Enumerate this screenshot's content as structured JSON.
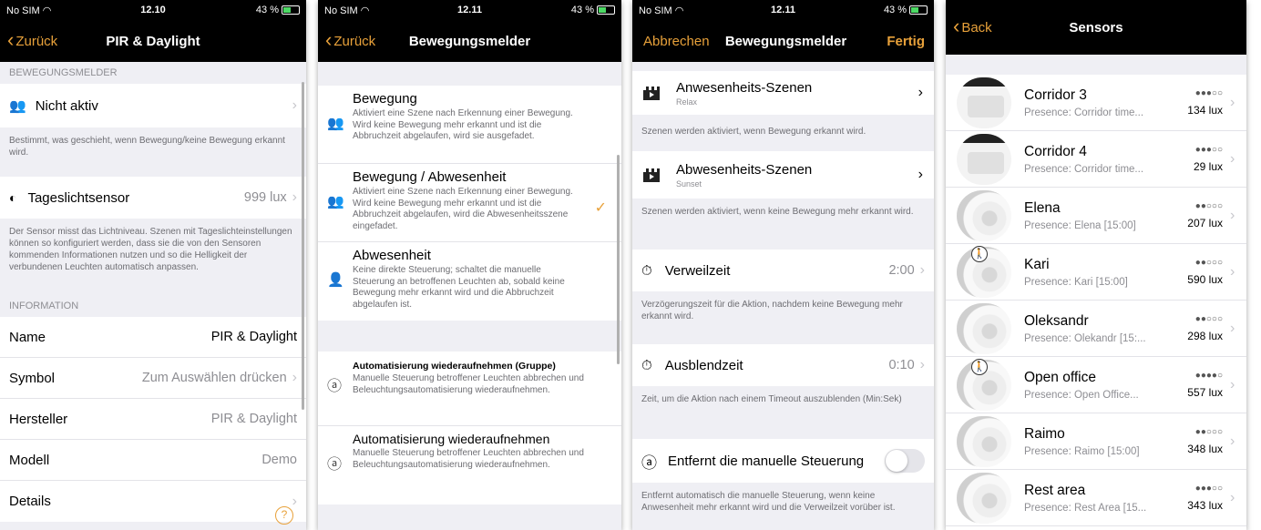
{
  "accent_color": "#e8a13a",
  "panels": [
    {
      "status": {
        "carrier": "No SIM",
        "time": "12.10",
        "battery": "43 %"
      },
      "nav": {
        "back": "Zurück",
        "title": "PIR & Daylight"
      },
      "section_motion": "BEWEGUNGSMELDER",
      "motion_cell": {
        "label": "Nicht aktiv"
      },
      "motion_footer": "Bestimmt, was geschieht, wenn Bewegung/keine Bewegung erkannt wird.",
      "daylight_cell": {
        "label": "Tageslichtsensor",
        "value": "999 lux"
      },
      "daylight_footer": "Der Sensor misst das Lichtniveau. Szenen mit Tageslichteinstellungen können so konfiguriert werden, dass sie die von den Sensoren kommenden Informationen nutzen und so die Helligkeit der verbundenen Leuchten automatisch anpassen.",
      "section_info": "INFORMATION",
      "info_rows": [
        {
          "label": "Name",
          "value": "PIR & Daylight"
        },
        {
          "label": "Symbol",
          "value": "Zum Auswählen drücken"
        },
        {
          "label": "Hersteller",
          "value": "PIR & Daylight"
        },
        {
          "label": "Modell",
          "value": "Demo"
        },
        {
          "label": "Details",
          "value": ""
        }
      ]
    },
    {
      "status": {
        "carrier": "No SIM",
        "time": "12.11",
        "battery": "43 %"
      },
      "nav": {
        "back": "Zurück",
        "title": "Bewegungsmelder"
      },
      "options": [
        {
          "title": "Bewegung",
          "desc": "Aktiviert eine Szene nach Erkennung einer Bewegung. Wird keine Bewegung mehr erkannt und ist die Abbruchzeit abgelaufen, wird sie ausgefadet."
        },
        {
          "title": "Bewegung / Abwesenheit",
          "desc": "Aktiviert eine Szene nach Erkennung einer Bewegung. Wird keine Bewegung mehr erkannt und ist die Abbruchzeit abgelaufen, wird die Abwesenheitsszene eingefadet.",
          "checked": "✓"
        },
        {
          "title": "Abwesenheit",
          "desc": "Keine direkte Steuerung; schaltet die manuelle Steuerung an betroffenen Leuchten ab, sobald keine Bewegung mehr erkannt wird und die Abbruchzeit abgelaufen ist."
        }
      ],
      "auto_options": [
        {
          "title": "Automatisierung wiederaufnehmen (Gruppe)",
          "desc": "Manuelle Steuerung betroffener Leuchten abbrechen und Beleuchtungsautomatisierung wiederaufnehmen."
        },
        {
          "title": "Automatisierung wiederaufnehmen",
          "desc": "Manuelle Steuerung betroffener Leuchten abbrechen und Beleuchtungsautomatisierung wiederaufnehmen."
        }
      ]
    },
    {
      "status": {
        "carrier": "No SIM",
        "time": "12.11",
        "battery": "43 %"
      },
      "nav": {
        "back": "Abbrechen",
        "title": "Bewegungsmelder",
        "done": "Fertig"
      },
      "presence_scene": {
        "label": "Anwesenheits-Szenen",
        "sub": "Relax"
      },
      "presence_footer": "Szenen werden aktiviert, wenn Bewegung erkannt wird.",
      "absence_scene": {
        "label": "Abwesenheits-Szenen",
        "sub": "Sunset"
      },
      "absence_footer": "Szenen werden aktiviert, wenn keine Bewegung mehr erkannt wird.",
      "dwell": {
        "label": "Verweilzeit",
        "value": "2:00"
      },
      "dwell_footer": "Verzögerungszeit für die Aktion, nachdem keine Bewegung mehr erkannt wird.",
      "fade": {
        "label": "Ausblendzeit",
        "value": "0:10"
      },
      "fade_footer": "Zeit, um die Aktion nach einem Timeout auszublenden (Min:Sek)",
      "manual": {
        "label": "Entfernt die manuelle Steuerung"
      },
      "manual_footer": "Entfernt automatisch die manuelle Steuerung, wenn keine Anwesenheit mehr erkannt wird und die Verweilzeit vorüber ist."
    },
    {
      "nav": {
        "back": "Back",
        "title": "Sensors"
      },
      "sensors": [
        {
          "name": "Corridor 3",
          "presence": "Presence: Corridor time...",
          "signal": "●●●○○",
          "lux": "134 lux",
          "img": "cam",
          "badge": ""
        },
        {
          "name": "Corridor 4",
          "presence": "Presence: Corridor time...",
          "signal": "●●●○○",
          "lux": "29 lux",
          "img": "cam",
          "badge": ""
        },
        {
          "name": "Elena",
          "presence": "Presence: Elena [15:00]",
          "signal": "●●○○○",
          "lux": "207 lux",
          "img": "dome",
          "badge": ""
        },
        {
          "name": "Kari",
          "presence": "Presence: Kari [15:00]",
          "signal": "●●○○○",
          "lux": "590 lux",
          "img": "dome",
          "badge": "🚶"
        },
        {
          "name": "Oleksandr",
          "presence": "Presence: Olekandr [15:...",
          "signal": "●●○○○",
          "lux": "298 lux",
          "img": "dome",
          "badge": ""
        },
        {
          "name": "Open office",
          "presence": "Presence: Open Office...",
          "signal": "●●●●○",
          "lux": "557 lux",
          "img": "dome",
          "badge": "🚶"
        },
        {
          "name": "Raimo",
          "presence": "Presence: Raimo [15:00]",
          "signal": "●●○○○",
          "lux": "348 lux",
          "img": "dome",
          "badge": ""
        },
        {
          "name": "Rest area",
          "presence": "Presence: Rest Area [15...",
          "signal": "●●●○○",
          "lux": "343 lux",
          "img": "dome",
          "badge": ""
        }
      ]
    }
  ]
}
